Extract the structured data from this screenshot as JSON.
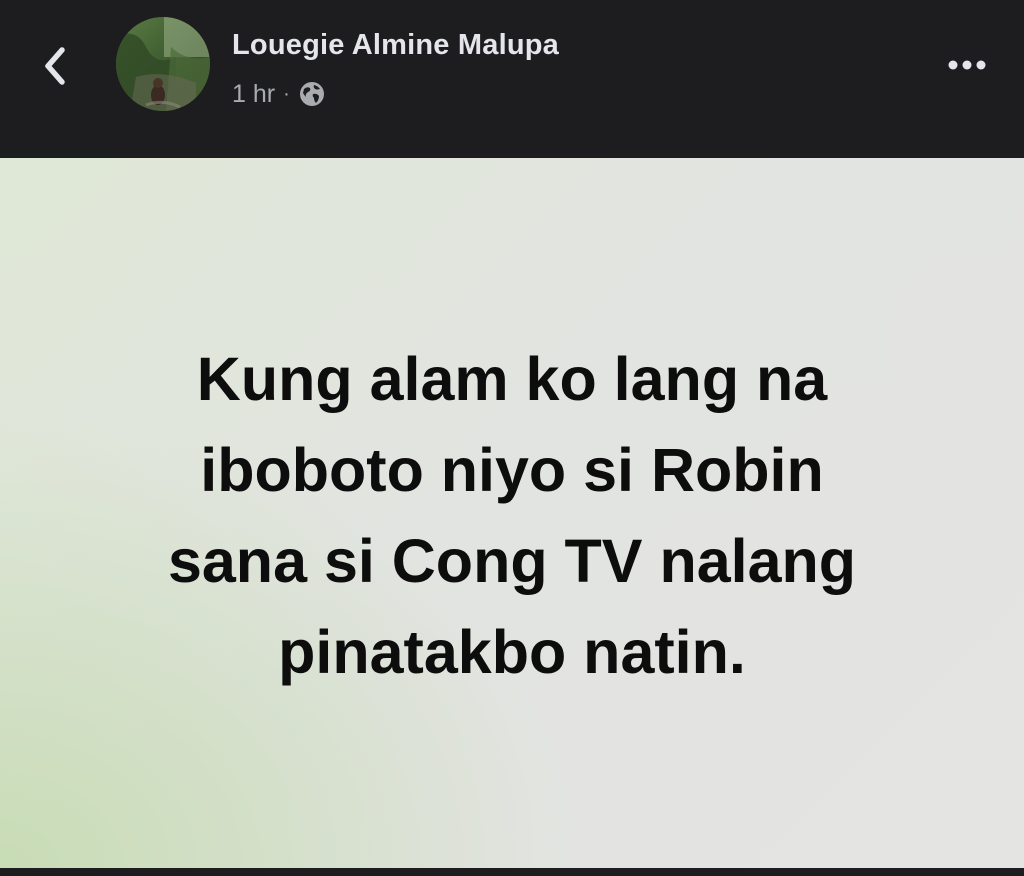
{
  "header": {
    "author_name": "Louegie Almine Malupa",
    "timestamp": "1 hr",
    "separator": "·",
    "privacy_icon": "globe-icon",
    "back_icon": "chevron-left-icon",
    "more_icon": "more-horizontal-icon"
  },
  "post": {
    "text": "Kung alam ko lang na\nibobotoniyo si Robin\nsana si Cong TV nalang\npinatakbo natin.",
    "background_accent": "#c8dcb5",
    "text_color": "#0d0d0d"
  },
  "colors": {
    "header_bg": "#1d1d1f",
    "author_text": "#e4e6eb",
    "meta_text": "#a8abb0"
  }
}
